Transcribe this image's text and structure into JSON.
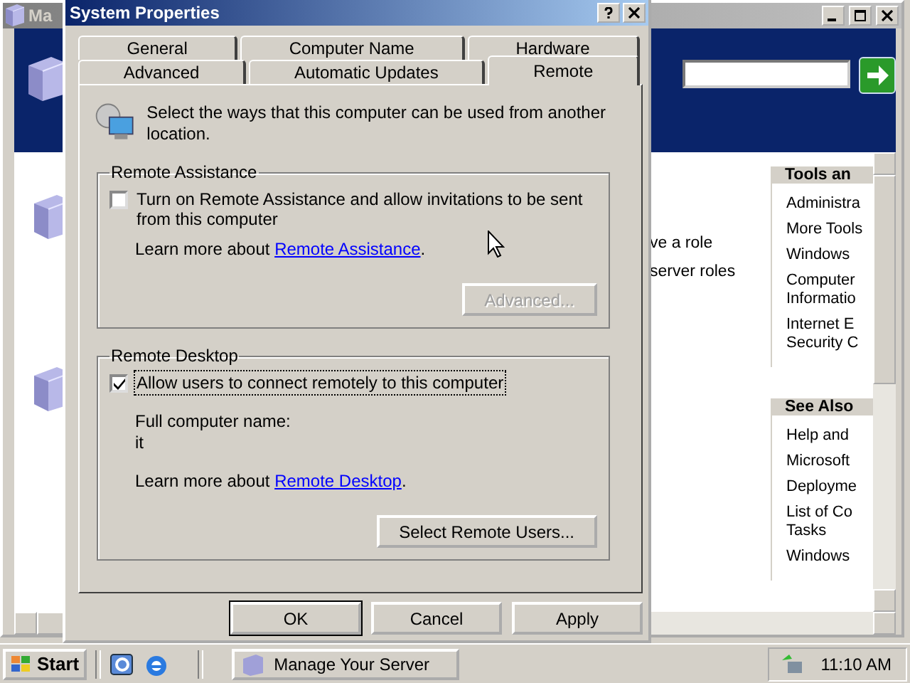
{
  "background_window": {
    "title": "Ma",
    "partial_texts": [
      "ve a role",
      "server roles"
    ],
    "panels": [
      {
        "title": "Tools an",
        "items": [
          {
            "lines": [
              "Administra"
            ]
          },
          {
            "lines": [
              "More Tools"
            ]
          },
          {
            "lines": [
              "Windows"
            ]
          },
          {
            "lines": [
              "Computer",
              "Informatio"
            ]
          },
          {
            "lines": [
              "Internet E",
              "Security C"
            ]
          }
        ]
      },
      {
        "title": "See Also",
        "items": [
          {
            "lines": [
              "Help and"
            ]
          },
          {
            "lines": [
              "Microsoft"
            ]
          },
          {
            "lines": [
              "Deployme"
            ]
          },
          {
            "lines": [
              "List of Co",
              "Tasks"
            ]
          },
          {
            "lines": [
              "Windows"
            ]
          }
        ]
      }
    ]
  },
  "dialog": {
    "title": "System Properties",
    "tab_rows": [
      [
        {
          "label": "General",
          "selected": false
        },
        {
          "label": "Computer Name",
          "selected": false
        },
        {
          "label": "Hardware",
          "selected": false
        }
      ],
      [
        {
          "label": "Advanced",
          "selected": false
        },
        {
          "label": "Automatic Updates",
          "selected": false
        },
        {
          "label": "Remote",
          "selected": true
        }
      ]
    ],
    "intro": "Select the ways that this computer can be used from another location.",
    "groups": [
      {
        "title": "Remote Assistance",
        "checkbox": {
          "label": "Turn on Remote Assistance and allow invitations to be sent from this computer",
          "checked": false,
          "focused": false
        },
        "learn_more": {
          "text": "Learn more about ",
          "link": "Remote Assistance",
          "after": "."
        },
        "button": {
          "label": "Advanced...",
          "disabled": true
        }
      },
      {
        "title": "Remote Desktop",
        "checkbox": {
          "label": "Allow users to connect remotely to this computer",
          "checked": true,
          "focused": true
        },
        "info": [
          "Full computer name:",
          "it"
        ],
        "learn_more": {
          "text": "Learn more about ",
          "link": "Remote Desktop",
          "after": "."
        },
        "button": {
          "label": "Select Remote Users...",
          "disabled": false
        }
      }
    ],
    "buttons": [
      {
        "label": "OK",
        "default": true
      },
      {
        "label": "Cancel",
        "default": false
      },
      {
        "label": "Apply",
        "default": false
      }
    ]
  },
  "taskbar": {
    "start": "Start",
    "tasks": [
      {
        "label": "Manage Your Server"
      }
    ],
    "clock": "11:10 AM"
  }
}
